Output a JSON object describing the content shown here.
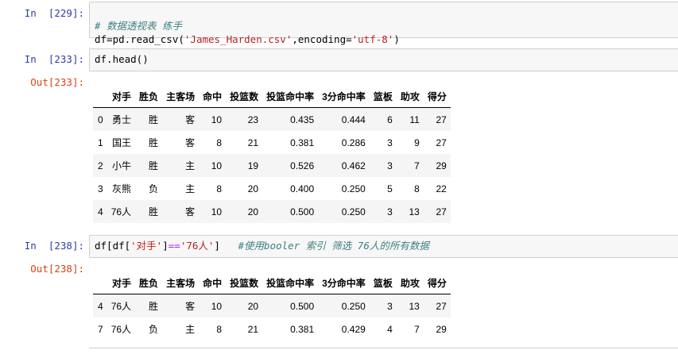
{
  "cells": [
    {
      "in_prompt": "In  [229]:",
      "code_comment": "# 数据透视表 练手",
      "code_line2": {
        "p1": "df=pd.read_csv(",
        "s1": "'James_Harden.csv'",
        "p2": ",encoding=",
        "s2": "'utf-8'",
        "p3": ")"
      }
    },
    {
      "in_prompt": "In  [233]:",
      "code": "df.head()",
      "out_prompt": "Out[233]:"
    },
    {
      "in_prompt": "In  [238]:",
      "code": {
        "p1": "df[df[",
        "s1": "'对手'",
        "p2": "]",
        "op": "==",
        "s2": "'76人'",
        "p3": "]",
        "comment": "#使用booler 索引 筛选 76人的所有数据"
      },
      "out_prompt": "Out[238]:"
    }
  ],
  "columns": [
    "对手",
    "胜负",
    "主客场",
    "命中",
    "投篮数",
    "投篮命中率",
    "3分命中率",
    "篮板",
    "助攻",
    "得分"
  ],
  "table1": [
    [
      "0",
      "勇士",
      "胜",
      "客",
      "10",
      "23",
      "0.435",
      "0.444",
      "6",
      "11",
      "27"
    ],
    [
      "1",
      "国王",
      "胜",
      "客",
      "8",
      "21",
      "0.381",
      "0.286",
      "3",
      "9",
      "27"
    ],
    [
      "2",
      "小牛",
      "胜",
      "主",
      "10",
      "19",
      "0.526",
      "0.462",
      "3",
      "7",
      "29"
    ],
    [
      "3",
      "灰熊",
      "负",
      "主",
      "8",
      "20",
      "0.400",
      "0.250",
      "5",
      "8",
      "22"
    ],
    [
      "4",
      "76人",
      "胜",
      "客",
      "10",
      "20",
      "0.500",
      "0.250",
      "3",
      "13",
      "27"
    ]
  ],
  "table2": [
    [
      "4",
      "76人",
      "胜",
      "客",
      "10",
      "20",
      "0.500",
      "0.250",
      "3",
      "13",
      "27"
    ],
    [
      "7",
      "76人",
      "负",
      "主",
      "8",
      "21",
      "0.381",
      "0.429",
      "4",
      "7",
      "29"
    ]
  ]
}
